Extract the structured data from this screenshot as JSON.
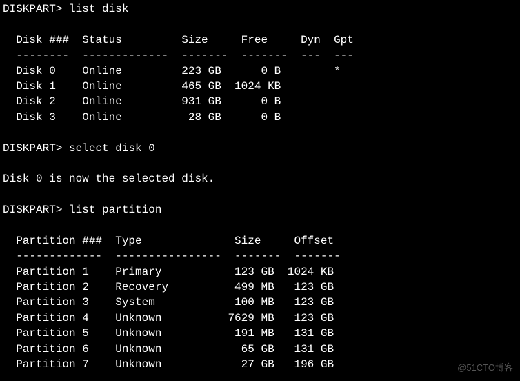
{
  "prompt_label": "DISKPART>",
  "commands": {
    "c1": "list disk",
    "c2": "select disk 0",
    "c3": "list partition"
  },
  "disk_header": {
    "col1": "Disk ###",
    "col2": "Status",
    "col3": "Size",
    "col4": "Free",
    "col5": "Dyn",
    "col6": "Gpt"
  },
  "disk_sep": {
    "s1": "--------",
    "s2": "-------------",
    "s3": "-------",
    "s4": "-------",
    "s5": "---",
    "s6": "---"
  },
  "disks": [
    {
      "name": "Disk 0",
      "status": "Online",
      "size": "223 GB",
      "free": "0 B",
      "dyn": "",
      "gpt": "*"
    },
    {
      "name": "Disk 1",
      "status": "Online",
      "size": "465 GB",
      "free": "1024 KB",
      "dyn": "",
      "gpt": ""
    },
    {
      "name": "Disk 2",
      "status": "Online",
      "size": "931 GB",
      "free": "0 B",
      "dyn": "",
      "gpt": ""
    },
    {
      "name": "Disk 3",
      "status": "Online",
      "size": "28 GB",
      "free": "0 B",
      "dyn": "",
      "gpt": ""
    }
  ],
  "select_response": "Disk 0 is now the selected disk.",
  "part_header": {
    "col1": "Partition ###",
    "col2": "Type",
    "col3": "Size",
    "col4": "Offset"
  },
  "part_sep": {
    "s1": "-------------",
    "s2": "----------------",
    "s3": "-------",
    "s4": "-------"
  },
  "partitions": [
    {
      "name": "Partition 1",
      "type": "Primary",
      "size": "123 GB",
      "offset": "1024 KB"
    },
    {
      "name": "Partition 2",
      "type": "Recovery",
      "size": "499 MB",
      "offset": "123 GB"
    },
    {
      "name": "Partition 3",
      "type": "System",
      "size": "100 MB",
      "offset": "123 GB"
    },
    {
      "name": "Partition 4",
      "type": "Unknown",
      "size": "7629 MB",
      "offset": "123 GB"
    },
    {
      "name": "Partition 5",
      "type": "Unknown",
      "size": "191 MB",
      "offset": "131 GB"
    },
    {
      "name": "Partition 6",
      "type": "Unknown",
      "size": "65 GB",
      "offset": "131 GB"
    },
    {
      "name": "Partition 7",
      "type": "Unknown",
      "size": "27 GB",
      "offset": "196 GB"
    }
  ],
  "watermark": "@51CTO博客"
}
